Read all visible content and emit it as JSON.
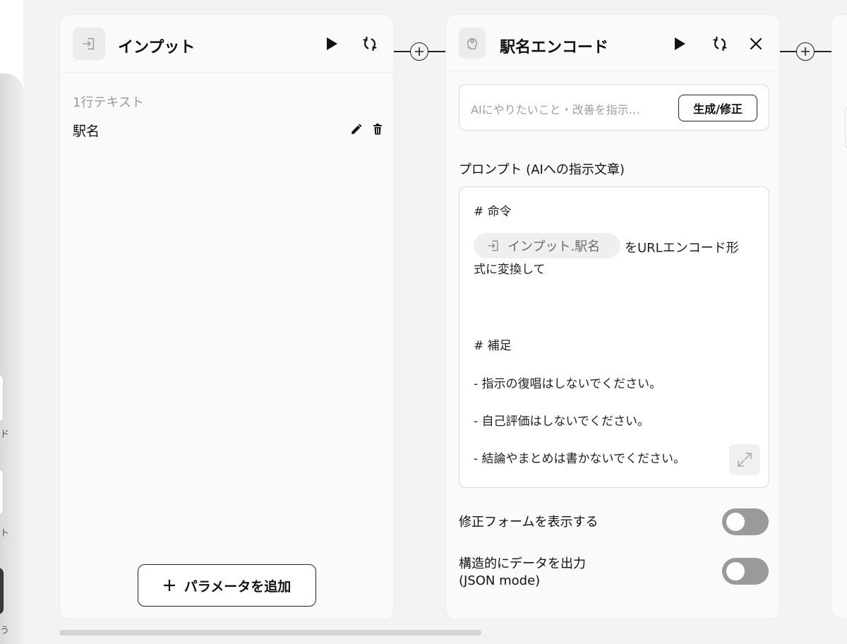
{
  "sidebar": {
    "labels": [
      "ド",
      "ト",
      "う"
    ]
  },
  "input_node": {
    "title": "インプット",
    "section_label": "1行テキスト",
    "params": [
      {
        "name": "駅名"
      }
    ],
    "add_param_label": "パラメータを追加",
    "add_param_icon": "plus"
  },
  "ai_node": {
    "title": "駅名エンコード",
    "ai_instruction_placeholder": "AIにやりたいこと・改善を指示…",
    "generate_button": "生成/修正",
    "prompt_label": "プロンプト (AIへの指示文章)",
    "prompt": {
      "heading1": "# 命令",
      "chip_label": "インプット.駅名",
      "line1_after_chip": "をURLエンコード形",
      "line2": "式に変換して",
      "heading2": "# 補足",
      "bullets": [
        "- 指示の復唱はしないでください。",
        "- 自己評価はしないでください。",
        "- 結論やまとめは書かないでください。"
      ]
    },
    "toggles": [
      {
        "label": "修正フォームを表示する",
        "on": false
      },
      {
        "label_line1": "構造的にデータを出力",
        "label_line2": "(JSON mode)",
        "on": false
      }
    ]
  },
  "colors": {
    "background": "#f3f3f3",
    "card": "#fafafa",
    "toggle_off": "#9a9a9a",
    "chip": "#efefef",
    "text": "#111111",
    "muted": "#9a9a9a"
  }
}
